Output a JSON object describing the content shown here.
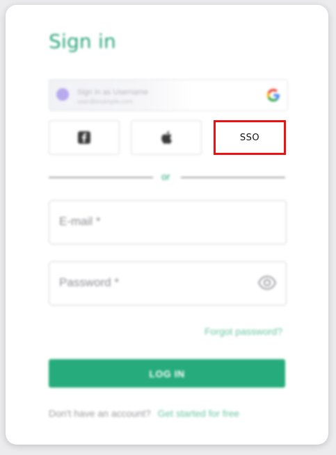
{
  "signin": {
    "title": "Sign in"
  },
  "google": {
    "line1": "Sign in as Username",
    "line2": "user@example.com",
    "icon": "google-logo"
  },
  "social": {
    "facebook_icon": "facebook-icon",
    "apple_icon": "apple-icon",
    "sso_label": "SSO"
  },
  "divider": {
    "text": "or"
  },
  "form": {
    "email_label": "E-mail *",
    "password_label": "Password *",
    "forgot_label": "Forgot password?",
    "login_label": "LOG IN"
  },
  "signup": {
    "prompt": "Don't have an account?",
    "link": "Get started for free"
  },
  "colors": {
    "brand_green": "#26ab7d",
    "highlight_red": "#ee1111"
  }
}
